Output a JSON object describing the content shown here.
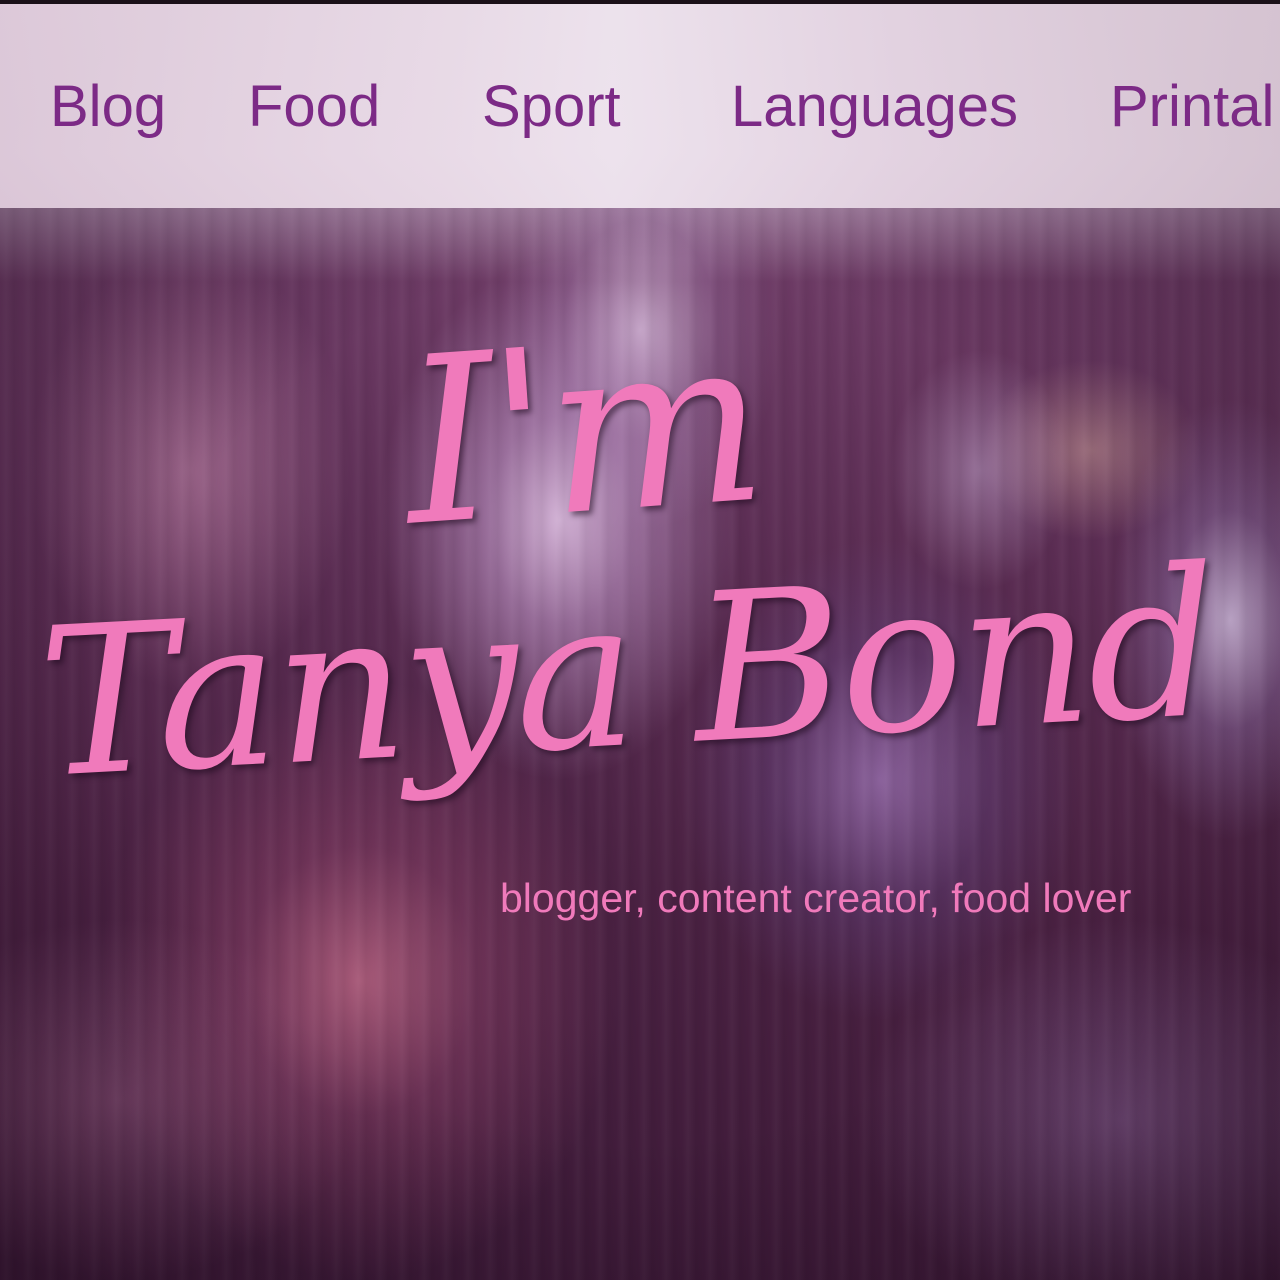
{
  "nav": {
    "items": [
      {
        "label": "Blog"
      },
      {
        "label": "Food"
      },
      {
        "label": "Sport"
      },
      {
        "label": "Languages"
      },
      {
        "label": "Printal"
      }
    ]
  },
  "hero": {
    "title_line1": "I'm",
    "title_line2": "Tanya Bond",
    "subtitle": "blogger, content creator, food lover"
  },
  "colors": {
    "nav_text": "#7c2a86",
    "hero_text": "#f07abb",
    "nav_background": "#e8dae6",
    "hero_background": "#4a2142"
  }
}
